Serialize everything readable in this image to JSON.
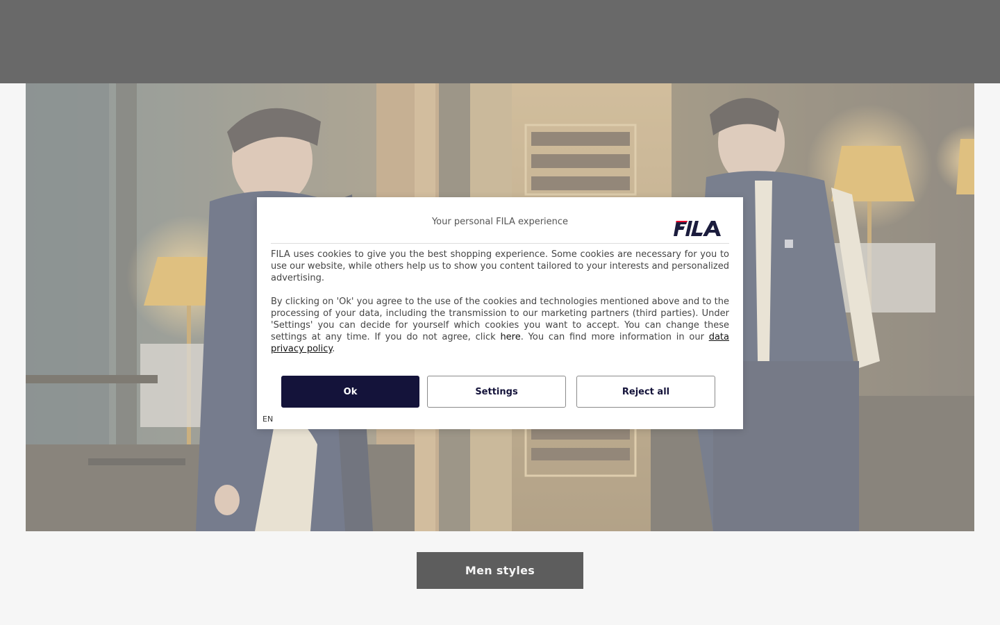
{
  "hero": {
    "image_alt": "Two men in FILA track jackets posing in a vintage room with lamps"
  },
  "cta": {
    "label": "Men styles"
  },
  "consent_dialog": {
    "title": "Your personal FILA experience",
    "brand_logo_text": "FILA",
    "paragraph_1": "FILA uses cookies to give you the best shopping experience. Some cookies are necessary for you to use our website, while others help us to show you content tailored to your interests and personalized advertising.",
    "paragraph_2_part_1": "By clicking on 'Ok' you agree to the use of the cookies and technologies mentioned above and to the processing of your data, including the transmission to our marketing partners (third parties). Under 'Settings' you can decide for yourself which cookies you want to accept. You can change these settings at any time. If you do not agree, click ",
    "here_link": "here",
    "paragraph_2_part_2": ". You can find more information in our ",
    "privacy_link": "data privacy policy",
    "paragraph_2_part_3": ".",
    "ok_label": "Ok",
    "settings_label": "Settings",
    "reject_label": "Reject all",
    "language": "EN"
  },
  "colors": {
    "primary_button": "#14133a",
    "logo_red": "#e4002b",
    "logo_navy": "#1b1c3d",
    "cta_background": "#000000"
  }
}
